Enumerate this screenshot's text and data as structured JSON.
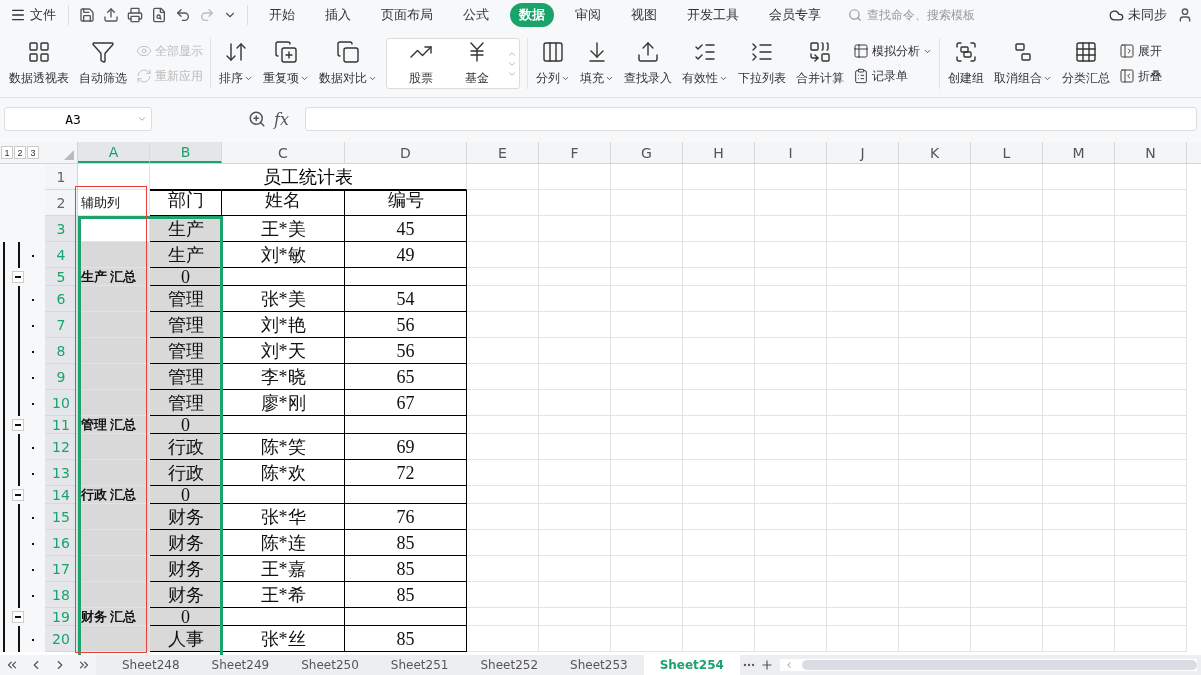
{
  "menu": {
    "file": "文件",
    "tabs": [
      {
        "label": "开始",
        "selected": false
      },
      {
        "label": "插入",
        "selected": false
      },
      {
        "label": "页面布局",
        "selected": false
      },
      {
        "label": "公式",
        "selected": false
      },
      {
        "label": "数据",
        "selected": true
      },
      {
        "label": "审阅",
        "selected": false
      },
      {
        "label": "视图",
        "selected": false
      },
      {
        "label": "开发工具",
        "selected": false
      },
      {
        "label": "会员专享",
        "selected": false
      }
    ],
    "search": {
      "placeholder": "查找命令、搜索模板"
    },
    "sync": "未同步"
  },
  "ribbon": [
    {
      "kind": "large",
      "label": "数据透视表",
      "dropdown": false
    },
    {
      "kind": "large",
      "label": "自动筛选",
      "dropdown": false
    },
    {
      "kind": "stack",
      "items": [
        {
          "label": "全部显示",
          "disabled": true,
          "dropdown": false
        },
        {
          "label": "重新应用",
          "disabled": true,
          "dropdown": false
        }
      ]
    },
    {
      "kind": "large",
      "label": "排序",
      "dropdown": true
    },
    {
      "kind": "large",
      "label": "重复项",
      "dropdown": true
    },
    {
      "kind": "large",
      "label": "数据对比",
      "dropdown": true
    },
    {
      "kind": "gallery",
      "items": [
        "股票",
        "基金"
      ]
    },
    {
      "kind": "large",
      "label": "分列",
      "dropdown": true
    },
    {
      "kind": "large",
      "label": "填充",
      "dropdown": true
    },
    {
      "kind": "large",
      "label": "查找录入",
      "dropdown": false
    },
    {
      "kind": "large",
      "label": "有效性",
      "dropdown": true
    },
    {
      "kind": "large",
      "label": "下拉列表",
      "dropdown": false
    },
    {
      "kind": "large",
      "label": "合并计算",
      "dropdown": false
    },
    {
      "kind": "stack",
      "items": [
        {
          "label": "模拟分析",
          "disabled": false,
          "dropdown": true
        },
        {
          "label": "记录单",
          "disabled": false,
          "dropdown": false
        }
      ]
    },
    {
      "kind": "large",
      "label": "创建组",
      "dropdown": false
    },
    {
      "kind": "large",
      "label": "取消组合",
      "dropdown": true
    },
    {
      "kind": "large",
      "label": "分类汇总",
      "dropdown": false
    },
    {
      "kind": "stack",
      "items": [
        {
          "label": "展开",
          "disabled": false,
          "dropdown": false
        },
        {
          "label": "折叠",
          "disabled": false,
          "dropdown": false
        }
      ]
    }
  ],
  "formula_bar": {
    "name_box": "A3",
    "fx": "fx"
  },
  "outline_levels": [
    "1",
    "2",
    "3"
  ],
  "columns": [
    {
      "label": "A",
      "selected": true
    },
    {
      "label": "B",
      "selected": true
    },
    {
      "label": "C",
      "selected": false
    },
    {
      "label": "D",
      "selected": false
    },
    {
      "label": "E",
      "selected": false
    },
    {
      "label": "F",
      "selected": false
    },
    {
      "label": "G",
      "selected": false
    },
    {
      "label": "H",
      "selected": false
    },
    {
      "label": "I",
      "selected": false
    },
    {
      "label": "J",
      "selected": false
    },
    {
      "label": "K",
      "selected": false
    },
    {
      "label": "L",
      "selected": false
    },
    {
      "label": "M",
      "selected": false
    },
    {
      "label": "N",
      "selected": false
    }
  ],
  "rows": [
    {
      "number": "1",
      "selected": false,
      "kind": "title",
      "title": "员工统计表"
    },
    {
      "number": "2",
      "selected": false,
      "kind": "header",
      "cells": [
        "辅助列",
        "部门",
        "姓名",
        "编号"
      ]
    },
    {
      "number": "3",
      "selected": true,
      "kind": "data",
      "grouped": false,
      "cells": [
        "",
        "生产",
        "王*美",
        "45"
      ]
    },
    {
      "number": "4",
      "selected": true,
      "kind": "data",
      "grouped": true,
      "cells": [
        "",
        "生产",
        "刘*敏",
        "49"
      ]
    },
    {
      "number": "5",
      "selected": true,
      "kind": "summary",
      "cells": [
        "生产 汇总",
        "0",
        "",
        ""
      ]
    },
    {
      "number": "6",
      "selected": true,
      "kind": "data",
      "grouped": true,
      "cells": [
        "",
        "管理",
        "张*美",
        "54"
      ]
    },
    {
      "number": "7",
      "selected": true,
      "kind": "data",
      "grouped": true,
      "cells": [
        "",
        "管理",
        "刘*艳",
        "56"
      ]
    },
    {
      "number": "8",
      "selected": true,
      "kind": "data",
      "grouped": true,
      "cells": [
        "",
        "管理",
        "刘*天",
        "56"
      ]
    },
    {
      "number": "9",
      "selected": true,
      "kind": "data",
      "grouped": true,
      "cells": [
        "",
        "管理",
        "李*晓",
        "65"
      ]
    },
    {
      "number": "10",
      "selected": true,
      "kind": "data",
      "grouped": true,
      "cells": [
        "",
        "管理",
        "廖*刚",
        "67"
      ]
    },
    {
      "number": "11",
      "selected": true,
      "kind": "summary",
      "cells": [
        "管理 汇总",
        "0",
        "",
        ""
      ]
    },
    {
      "number": "12",
      "selected": true,
      "kind": "data",
      "grouped": true,
      "cells": [
        "",
        "行政",
        "陈*笑",
        "69"
      ]
    },
    {
      "number": "13",
      "selected": true,
      "kind": "data",
      "grouped": true,
      "cells": [
        "",
        "行政",
        "陈*欢",
        "72"
      ]
    },
    {
      "number": "14",
      "selected": true,
      "kind": "summary",
      "cells": [
        "行政 汇总",
        "0",
        "",
        ""
      ]
    },
    {
      "number": "15",
      "selected": true,
      "kind": "data",
      "grouped": true,
      "cells": [
        "",
        "财务",
        "张*华",
        "76"
      ]
    },
    {
      "number": "16",
      "selected": true,
      "kind": "data",
      "grouped": true,
      "cells": [
        "",
        "财务",
        "陈*连",
        "85"
      ]
    },
    {
      "number": "17",
      "selected": true,
      "kind": "data",
      "grouped": true,
      "cells": [
        "",
        "财务",
        "王*嘉",
        "85"
      ]
    },
    {
      "number": "18",
      "selected": true,
      "kind": "data",
      "grouped": true,
      "cells": [
        "",
        "财务",
        "王*希",
        "85"
      ]
    },
    {
      "number": "19",
      "selected": true,
      "kind": "summary",
      "cells": [
        "财务 汇总",
        "0",
        "",
        ""
      ]
    },
    {
      "number": "20",
      "selected": true,
      "kind": "data",
      "grouped": true,
      "cells": [
        "",
        "人事",
        "张*丝",
        "85"
      ]
    }
  ],
  "sheets": [
    {
      "label": "Sheet248",
      "selected": false
    },
    {
      "label": "Sheet249",
      "selected": false
    },
    {
      "label": "Sheet250",
      "selected": false
    },
    {
      "label": "Sheet251",
      "selected": false
    },
    {
      "label": "Sheet252",
      "selected": false
    },
    {
      "label": "Sheet253",
      "selected": false
    },
    {
      "label": "Sheet254",
      "selected": true
    }
  ]
}
